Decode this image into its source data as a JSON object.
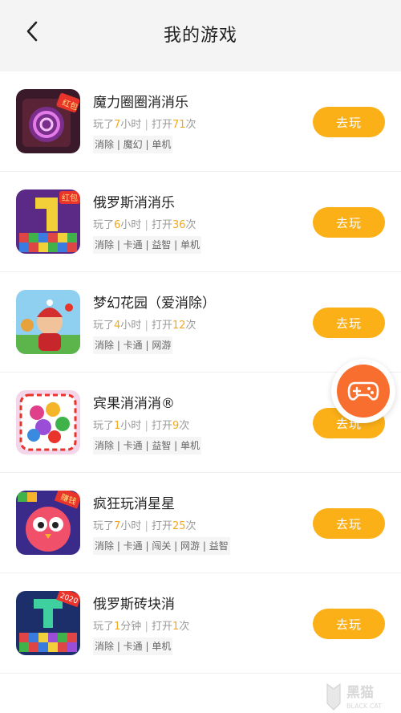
{
  "header": {
    "title": "我的游戏",
    "back_icon": "chevron-left-icon"
  },
  "games": [
    {
      "name": "魔力圈圈消消乐",
      "stats": {
        "prefix": "玩了",
        "duration": "7",
        "duration_unit": "小时",
        "sep": " | ",
        "open_label": "打开",
        "count": "71",
        "count_unit": "次"
      },
      "tags": "消除 | 魔幻 | 单机",
      "button": "去玩",
      "badge": "红包"
    },
    {
      "name": "俄罗斯消消乐",
      "stats": {
        "prefix": "玩了",
        "duration": "6",
        "duration_unit": "小时",
        "sep": " | ",
        "open_label": "打开",
        "count": "36",
        "count_unit": "次"
      },
      "tags": "消除 | 卡通 | 益智 | 单机",
      "button": "去玩",
      "badge": "红包"
    },
    {
      "name": "梦幻花园（爱消除）",
      "stats": {
        "prefix": "玩了",
        "duration": "4",
        "duration_unit": "小时",
        "sep": " | ",
        "open_label": "打开",
        "count": "12",
        "count_unit": "次"
      },
      "tags": "消除 | 卡通 | 网游",
      "button": "去玩"
    },
    {
      "name": "宾果消消消®",
      "stats": {
        "prefix": "玩了",
        "duration": "1",
        "duration_unit": "小时",
        "sep": " | ",
        "open_label": "打开",
        "count": "9",
        "count_unit": "次"
      },
      "tags": "消除 | 卡通 | 益智 | 单机",
      "button": "去玩"
    },
    {
      "name": "疯狂玩消星星",
      "stats": {
        "prefix": "玩了",
        "duration": "7",
        "duration_unit": "小时",
        "sep": " | ",
        "open_label": "打开",
        "count": "25",
        "count_unit": "次"
      },
      "tags": "消除 | 卡通 | 闯关 | 网游 | 益智",
      "button": "去玩",
      "badge": "赚钱"
    },
    {
      "name": "俄罗斯砖块消",
      "stats": {
        "prefix": "玩了",
        "duration": "1",
        "duration_unit": "分钟",
        "sep": " | ",
        "open_label": "打开",
        "count": "1",
        "count_unit": "次"
      },
      "tags": "消除 | 卡通 | 单机",
      "button": "去玩",
      "badge": "2020"
    }
  ],
  "floating_button": {
    "icon": "gamepad-icon"
  },
  "watermark": {
    "cn": "黑猫",
    "en": "BLACK CAT"
  },
  "colors": {
    "accent": "#fbb017",
    "highlight": "#f5a81c",
    "float": "#f86e2e"
  }
}
